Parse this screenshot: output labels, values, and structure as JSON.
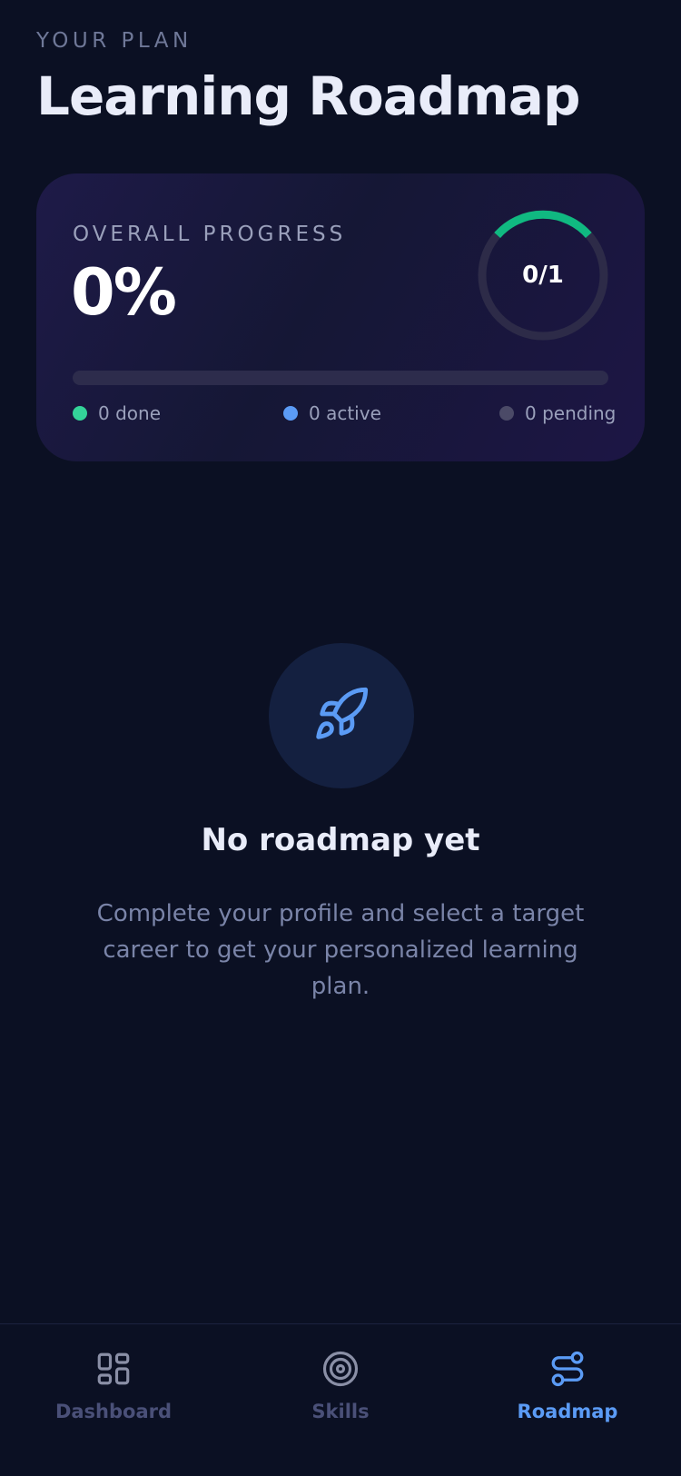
{
  "header": {
    "eyebrow": "YOUR PLAN",
    "title": "Learning Roadmap"
  },
  "progress_card": {
    "label": "OVERALL PROGRESS",
    "percent_text": "0%",
    "ring_text": "0/1",
    "progress_fraction": 0,
    "legend": {
      "done": "0 done",
      "active": "0 active",
      "pending": "0 pending"
    },
    "colors": {
      "done": "#34d399",
      "active": "#5b9bf5",
      "pending": "#4b4a67"
    }
  },
  "empty_state": {
    "icon": "rocket-icon",
    "title": "No roadmap yet",
    "description": "Complete your profile and select a target career to get your personalized learning plan."
  },
  "bottom_nav": {
    "items": [
      {
        "label": "Dashboard",
        "icon": "dashboard-icon",
        "active": false
      },
      {
        "label": "Skills",
        "icon": "target-icon",
        "active": false
      },
      {
        "label": "Roadmap",
        "icon": "route-icon",
        "active": true
      }
    ],
    "active_color": "#5b9bf5"
  }
}
